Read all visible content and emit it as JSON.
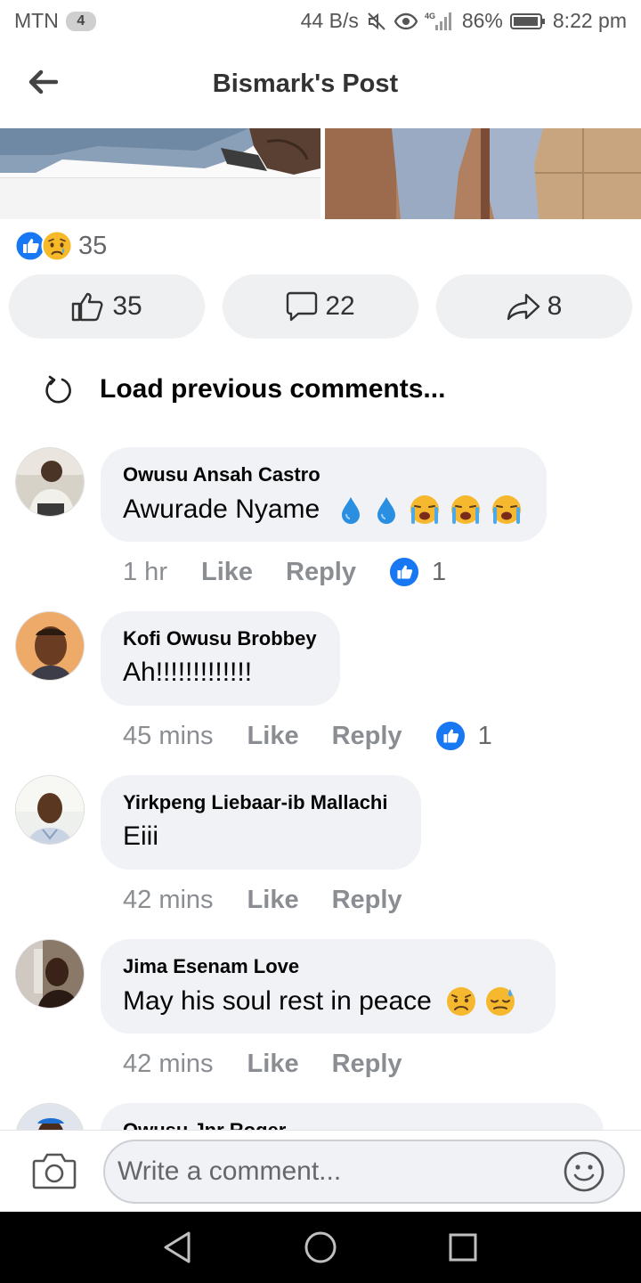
{
  "status_bar": {
    "carrier": "MTN",
    "sim_badge": "4",
    "net_speed": "44 B/s",
    "network": "4G",
    "battery": "86%",
    "time": "8:22 pm"
  },
  "header": {
    "title": "Bismark's Post"
  },
  "post": {
    "reaction_count": "35",
    "reactions": [
      "like-reaction-icon",
      "sad-reaction-icon"
    ],
    "like_count": "35",
    "comment_count": "22",
    "share_count": "8"
  },
  "load_previous": "Load previous comments...",
  "comments": [
    {
      "author": "Owusu Ansah Castro",
      "text": "Awurade Nyame",
      "emojis": [
        "droplet-emoji",
        "droplet-emoji",
        "crying-face-emoji",
        "crying-face-emoji",
        "crying-face-emoji"
      ],
      "time": "1 hr",
      "like_label": "Like",
      "reply_label": "Reply",
      "reactions": "1"
    },
    {
      "author": "Kofi Owusu Brobbey",
      "text": "Ah!!!!!!!!!!!!!",
      "emojis": [],
      "time": "45 mins",
      "like_label": "Like",
      "reply_label": "Reply",
      "reactions": "1"
    },
    {
      "author": "Yirkpeng Liebaar-ib Mallachi",
      "text": "Eiii",
      "emojis": [],
      "time": "42 mins",
      "like_label": "Like",
      "reply_label": "Reply",
      "reactions": ""
    },
    {
      "author": "Jima Esenam Love",
      "text": "May his soul rest in peace",
      "emojis": [
        "worried-face-emoji",
        "downcast-sweat-face-emoji"
      ],
      "time": "42 mins",
      "like_label": "Like",
      "reply_label": "Reply",
      "reactions": ""
    }
  ],
  "partial_comment": {
    "author": "Owusu Jnr Roger"
  },
  "composer": {
    "placeholder": "Write a comment..."
  },
  "colors": {
    "like_blue": "#1877f2",
    "bubble_bg": "#f0f2f5",
    "muted_text": "#8a8d91",
    "sad_yellow": "#f7b928"
  }
}
